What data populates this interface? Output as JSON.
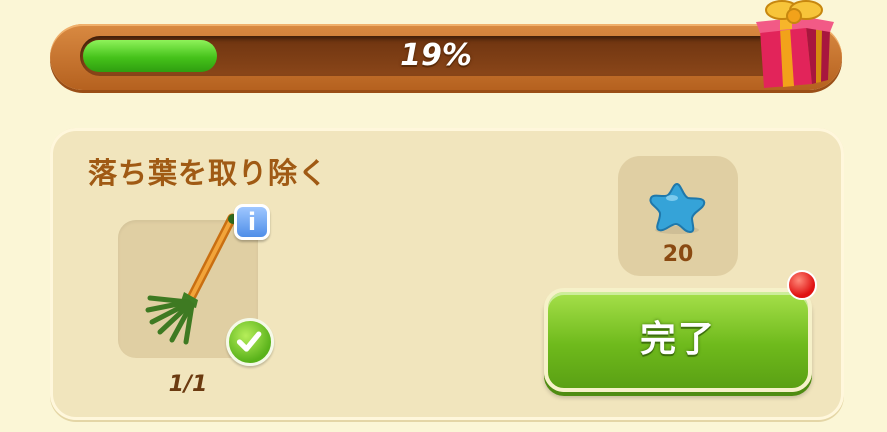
{
  "progress": {
    "percent": 19,
    "label": "19%",
    "fill_color": "#45c21a"
  },
  "task": {
    "title": "落ち葉を取り除く",
    "item": {
      "icon": "rake-icon",
      "count_label": "1/1",
      "completed": true,
      "info_label": "i"
    },
    "reward": {
      "icon": "blue-star-icon",
      "value": "20"
    },
    "done_button_label": "完了",
    "has_notification": true
  },
  "colors": {
    "background": "#fbf6d6",
    "bar_frame": "#c8702c",
    "panel": "#f1e5bd",
    "button_green": "#6fba1c",
    "title_brown": "#a05a14"
  }
}
